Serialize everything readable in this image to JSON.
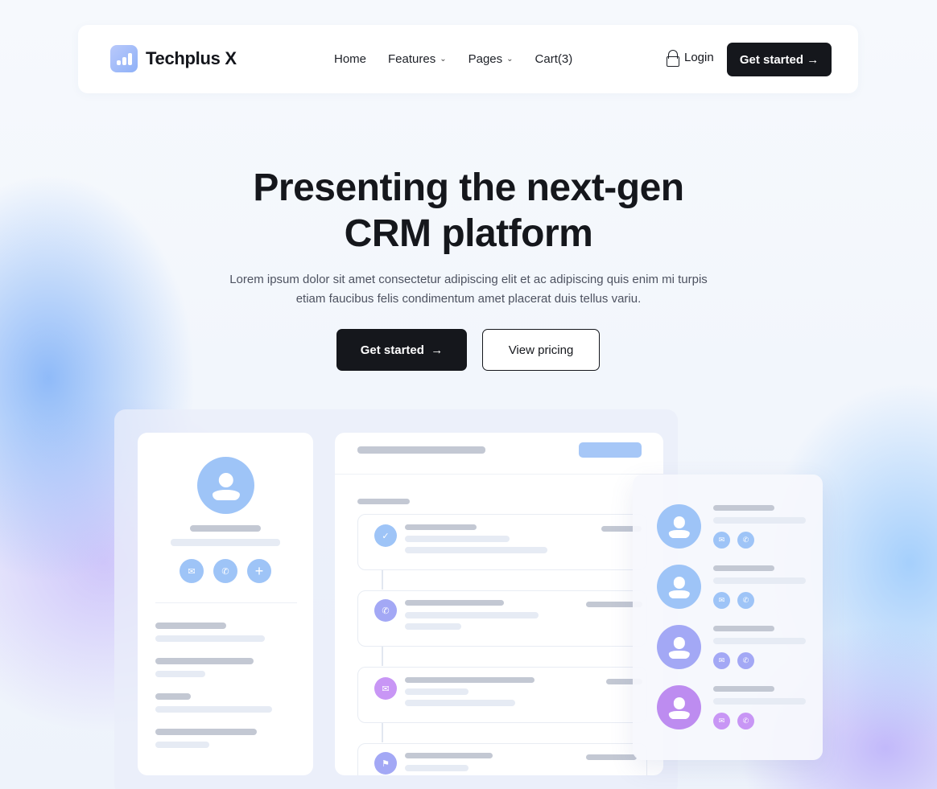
{
  "brand": {
    "name": "Techplus X"
  },
  "nav": {
    "items": [
      {
        "label": "Home",
        "dropdown": false
      },
      {
        "label": "Features",
        "dropdown": true
      },
      {
        "label": "Pages",
        "dropdown": true
      },
      {
        "label": "Cart(3)",
        "dropdown": false
      }
    ],
    "login_label": "Login",
    "cta_label": "Get started",
    "cta_arrow": "→"
  },
  "hero": {
    "title_line1": "Presenting the next-gen",
    "title_line2": "CRM platform",
    "subtitle": "Lorem ipsum dolor sit amet consectetur adipiscing elit et ac adipiscing quis enim mi turpis etiam faucibus felis condimentum amet placerat duis tellus variu.",
    "primary_label": "Get started",
    "primary_arrow": "→",
    "secondary_label": "View pricing"
  },
  "icons": {
    "mail": "✉",
    "phone": "✆",
    "plus": "+",
    "check": "✓",
    "flag": "⚑",
    "chevron": "⌄"
  },
  "colors": {
    "dark": "#15171c",
    "blue": "#9ec4f7",
    "indigo": "#a3a8f5",
    "purple": "#c896f5",
    "violet": "#bd8cf0",
    "placeholder_dark": "#c3c8d3",
    "placeholder_light": "#e6ebf4"
  }
}
